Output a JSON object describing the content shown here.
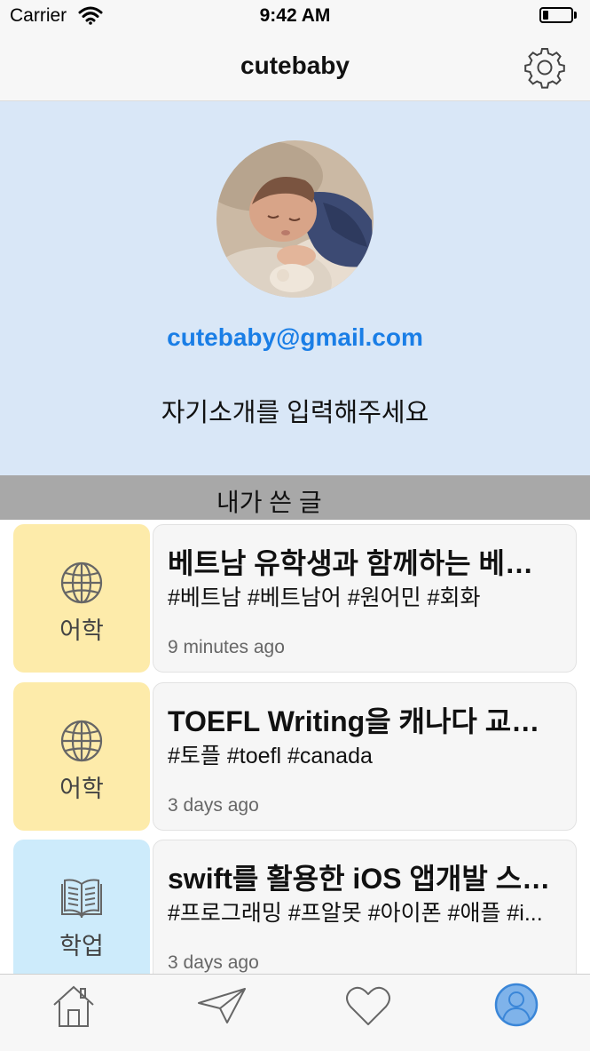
{
  "status_bar": {
    "carrier": "Carrier",
    "time": "9:42 AM",
    "battery_level": 0.2
  },
  "nav": {
    "title": "cutebaby",
    "settings_icon": "gear-icon"
  },
  "profile": {
    "email": "cutebaby@gmail.com",
    "intro": "자기소개를 입력해주세요"
  },
  "section": {
    "title": "내가 쓴 글"
  },
  "posts": [
    {
      "category": "어학",
      "category_icon": "globe-icon",
      "category_color": "#fdebaa",
      "title": "베트남 유학생과 함께하는 베…",
      "tags": "#베트남 #베트남어 #원어민 #회화",
      "time": "9 minutes ago"
    },
    {
      "category": "어학",
      "category_icon": "globe-icon",
      "category_color": "#fdebaa",
      "title": "TOEFL Writing을 캐나다 교…",
      "tags": "#토플 #toefl #canada",
      "time": "3 days ago"
    },
    {
      "category": "학업",
      "category_icon": "book-icon",
      "category_color": "#cdebfb",
      "title": "swift를 활용한 iOS 앱개발 스…",
      "tags": "#프로그래밍 #프알못 #아이폰 #애플 #i...",
      "time": "3 days ago"
    }
  ],
  "tab_bar": {
    "tabs": [
      {
        "icon": "home-icon",
        "selected": false
      },
      {
        "icon": "send-icon",
        "selected": false
      },
      {
        "icon": "heart-icon",
        "selected": false
      },
      {
        "icon": "profile-icon",
        "selected": true
      }
    ],
    "accent_color": "#4a90e2"
  }
}
